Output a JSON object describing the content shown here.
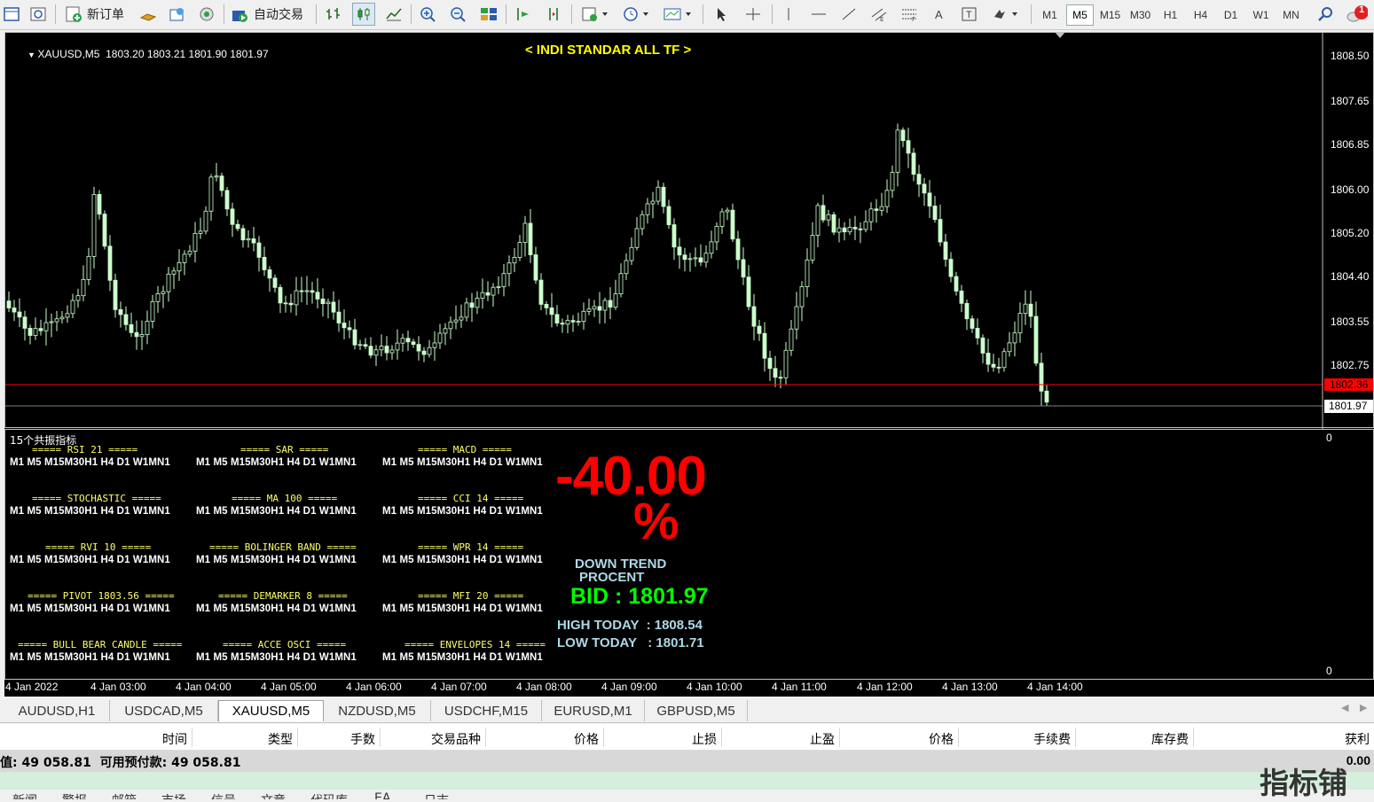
{
  "toolbar": {
    "new_order": "新订单",
    "auto_trade": "自动交易",
    "timeframes": [
      "M1",
      "M5",
      "M15",
      "M30",
      "H1",
      "H4",
      "D1",
      "W1",
      "MN"
    ],
    "active_timeframe": "M5",
    "notification_count": "1"
  },
  "chart": {
    "header": "XAUUSD,M5  1803.20 1803.21 1801.90 1801.97",
    "banner": "< INDI STANDAR ALL TF >",
    "price_labels": [
      "1808.50",
      "1807.65",
      "1806.85",
      "1806.00",
      "1805.20",
      "1804.40",
      "1803.55",
      "1802.75"
    ],
    "red_line_label": "1802.36",
    "current_price_label": "1801.97",
    "time_labels": [
      "4 Jan 2022",
      "4 Jan 03:00",
      "4 Jan 04:00",
      "4 Jan 05:00",
      "4 Jan 06:00",
      "4 Jan 07:00",
      "4 Jan 08:00",
      "4 Jan 09:00",
      "4 Jan 10:00",
      "4 Jan 11:00",
      "4 Jan 12:00",
      "4 Jan 13:00",
      "4 Jan 14:00"
    ],
    "colors": {
      "bull": "#ccffcc",
      "bear": "#ccffcc",
      "wick": "#ccffcc",
      "red_line": "#ff0000",
      "grey_line": "#808080"
    }
  },
  "indicator": {
    "window_title": "15个共振指标",
    "axis_top": "0",
    "axis_bottom": "0",
    "tf_row": "M1 M5 M15M30H1 H4 D1 W1MN1",
    "blocks": [
      "===== RSI 21 =====",
      "===== SAR =====",
      "===== MACD =====",
      "===== STOCHASTIC =====",
      "===== MA 100 =====",
      "===== CCI 14 =====",
      "===== RVI 10 =====",
      "===== BOLINGER BAND =====",
      "===== WPR 14 =====",
      "===== PIVOT 1803.56 =====",
      "===== DEMARKER 8 =====",
      "===== MFI 20 =====",
      "===== BULL BEAR CANDLE =====",
      "===== ACCE OSCI =====",
      "===== ENVELOPES 14 ====="
    ],
    "percent_value": "-40.00",
    "percent_sign": "%",
    "trend_line1": "DOWN TREND",
    "trend_line2": "PROCENT",
    "bid": "BID : 1801.97",
    "high_today": "HIGH TODAY  : 1808.54",
    "low_today": "LOW TODAY   : 1801.71",
    "colors": {
      "percent": "#ff0000",
      "trend": "#add8e6",
      "bid": "#00ff00",
      "hilo": "#add8e6"
    }
  },
  "tabs": [
    "AUDUSD,H1",
    "USDCAD,M5",
    "XAUUSD,M5",
    "NZDUSD,M5",
    "USDCHF,M15",
    "EURUSD,M1",
    "GBPUSD,M5"
  ],
  "active_tab": "XAUUSD,M5",
  "terminal": {
    "columns": [
      "时间",
      "类型",
      "手数",
      "交易品种",
      "价格",
      "止损",
      "止盈",
      "价格",
      "手续费",
      "库存费",
      "获利"
    ],
    "balance_line": "值: 49 058.81  可用预付款: 49 058.81",
    "profit": "0.00",
    "bottom_tabs": [
      "新闻",
      "警报",
      "邮箱",
      "市场",
      "信号",
      "文章",
      "代码库",
      "EA",
      "日志"
    ],
    "watermark": "指标铺"
  }
}
